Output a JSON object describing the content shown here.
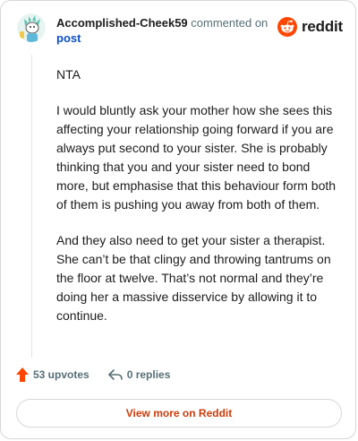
{
  "comment": {
    "author": "Accomplished-Cheek59",
    "action_text": "commented on",
    "link_text": "post",
    "paragraphs": [
      "NTA",
      "I would bluntly ask your mother how she sees this affecting your relationship going forward if you are always put second to your sister. She is probably thinking that you and your sister need to bond more, but emphasise that this behaviour form both of them is pushing you away from both of them.",
      "And they also need to get your sister a therapist. She can’t be that clingy and throwing tantrums on the floor at twelve. That’s not normal and they’re doing her a massive disservice by allowing it to continue."
    ]
  },
  "brand": {
    "name": "reddit",
    "icon": "reddit-logo-icon",
    "color": "#ff4500"
  },
  "stats": {
    "upvotes_label": "53 upvotes",
    "replies_label": "0 replies"
  },
  "footer": {
    "view_more_label": "View more on Reddit"
  },
  "colors": {
    "accent": "#ff4500",
    "link": "#0b4fc7",
    "view_more": "#cc3a0a"
  }
}
